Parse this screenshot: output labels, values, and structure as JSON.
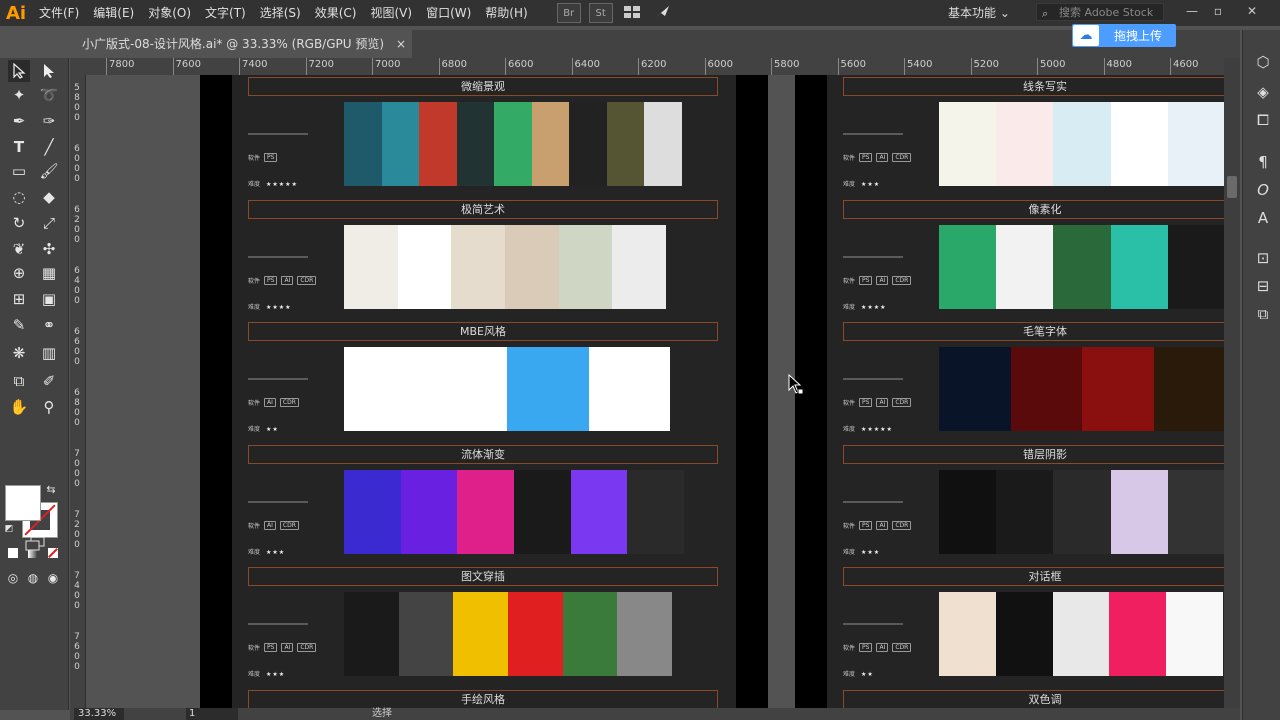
{
  "app": {
    "logo": "Ai"
  },
  "menu": [
    "文件(F)",
    "编辑(E)",
    "对象(O)",
    "文字(T)",
    "选择(S)",
    "效果(C)",
    "视图(V)",
    "窗口(W)",
    "帮助(H)"
  ],
  "menubar_buttons": [
    "Br",
    "St"
  ],
  "workspace": {
    "label": "基本功能"
  },
  "search": {
    "placeholder": "搜索 Adobe Stock"
  },
  "upload": {
    "label": "拖拽上传"
  },
  "document_tab": {
    "title": "小广版式-08-设计风格.ai* @ 33.33% (RGB/GPU 预览)",
    "close": "×"
  },
  "ruler_h": [
    "7800",
    "7600",
    "7400",
    "7200",
    "7000",
    "6800",
    "6600",
    "6400",
    "6200",
    "6000",
    "5800",
    "5600",
    "5400",
    "5200",
    "5000",
    "4800",
    "4600"
  ],
  "ruler_v": [
    "5",
    "8",
    "0",
    "0",
    "6",
    "0",
    "0",
    "0",
    "6",
    "2",
    "0",
    "0",
    "6",
    "4",
    "0",
    "0",
    "6",
    "6",
    "0",
    "0",
    "6",
    "8",
    "0",
    "0",
    "7",
    "0",
    "0",
    "0",
    "7",
    "2",
    "0",
    "0",
    "7",
    "4",
    "0",
    "0",
    "7",
    "6",
    "0",
    "0"
  ],
  "labels": {
    "software": "软件",
    "difficulty": "难度"
  },
  "left_page": {
    "sections": [
      {
        "title": "微缩景观",
        "software": [
          "PS"
        ],
        "stars": "★★★★★",
        "colors": [
          "#1e5a6a",
          "#2b8a9a",
          "#c0392b",
          "#233",
          "#3a6",
          "#c8a070",
          "#222",
          "#553",
          "#ddd"
        ]
      },
      {
        "title": "极简艺术",
        "software": [
          "PS",
          "AI",
          "CDR"
        ],
        "stars": "★★★★",
        "colors": [
          "#f0ede6",
          "#fff",
          "#e6dccd",
          "#d9cbb7",
          "#cfd6c4",
          "#ececec"
        ]
      },
      {
        "title": "MBE风格",
        "software": [
          "AI",
          "CDR"
        ],
        "stars": "★★",
        "colors": [
          "#ffffff",
          "#ffffff",
          "#3aa8f0",
          "#ffffff"
        ]
      },
      {
        "title": "流体渐变",
        "software": [
          "AI",
          "CDR"
        ],
        "stars": "★★★",
        "colors": [
          "#3a2ad0",
          "#6a20e0",
          "#e0208a",
          "#1a1a1a",
          "#7a38f0",
          "#2a2a2a"
        ]
      },
      {
        "title": "图文穿插",
        "software": [
          "PS",
          "AI",
          "CDR"
        ],
        "stars": "★★★",
        "colors": [
          "#1a1a1a",
          "#444",
          "#f0c000",
          "#e02020",
          "#3a7a3a",
          "#888"
        ]
      },
      {
        "title": "手绘风格"
      }
    ]
  },
  "right_page": {
    "sections": [
      {
        "title": "线条写实",
        "software": [
          "PS",
          "AI",
          "CDR"
        ],
        "stars": "★★★",
        "colors": [
          "#f4f4ea",
          "#fbeaea",
          "#d8ecf4",
          "#ffffff",
          "#e8f0f8"
        ]
      },
      {
        "title": "像素化",
        "software": [
          "PS",
          "AI",
          "CDR"
        ],
        "stars": "★★★★",
        "colors": [
          "#2aa86a",
          "#f2f2f2",
          "#2a6a3a",
          "#2ac0a8",
          "#1a1a1a"
        ]
      },
      {
        "title": "毛笔字体",
        "software": [
          "PS",
          "AI",
          "CDR"
        ],
        "stars": "★★★★★",
        "colors": [
          "#0a1428",
          "#5a0a0a",
          "#8a1010",
          "#2a1a0a"
        ]
      },
      {
        "title": "错层阴影",
        "software": [
          "PS",
          "AI",
          "CDR"
        ],
        "stars": "★★★",
        "colors": [
          "#101010",
          "#1a1a1a",
          "#2a2a2a",
          "#d8c8e8",
          "#333"
        ]
      },
      {
        "title": "对话框",
        "software": [
          "PS",
          "AI",
          "CDR"
        ],
        "stars": "★★",
        "colors": [
          "#f0e0d0",
          "#111",
          "#e8e8e8",
          "#f02060",
          "#f8f8f8"
        ]
      },
      {
        "title": "双色调"
      }
    ]
  },
  "status": {
    "zoom": "33.33%",
    "page": "1",
    "text": "选择"
  }
}
